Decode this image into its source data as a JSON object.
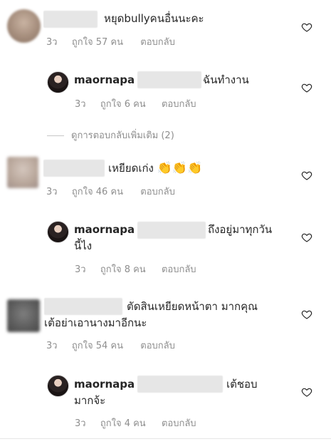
{
  "comments": [
    {
      "text": "หยุดbullyคนอื่นนะคะ",
      "time": "3ว",
      "likes": "ถูกใจ 57 คน",
      "reply": "ตอบกลับ"
    },
    {
      "username": "maornapa",
      "text": "ฉันทำงาน",
      "time": "3ว",
      "likes": "ถูกใจ 6 คน",
      "reply": "ตอบกลับ"
    },
    {
      "text": "เหยียดเก่ง",
      "emoji": "👏👏👏",
      "time": "3ว",
      "likes": "ถูกใจ 46 คน",
      "reply": "ตอบกลับ"
    },
    {
      "username": "maornapa",
      "text_line1": "ถึงอยู่มาทุกวัน",
      "text_line2": "นี้ไง",
      "time": "3ว",
      "likes": "ถูกใจ 8 คน",
      "reply": "ตอบกลับ"
    },
    {
      "text_line1": "ตัดสินเหยียดหน้าตา มากคุณ",
      "text_line2": "เต้อย่าเอานางมาอีกนะ",
      "time": "3ว",
      "likes": "ถูกใจ 54 คน",
      "reply": "ตอบกลับ"
    },
    {
      "username": "maornapa",
      "text_line1": "เต้ชอบ",
      "text_line2": "มากจ้ะ",
      "time": "3ว",
      "likes": "ถูกใจ 4 คน",
      "reply": "ตอบกลับ"
    }
  ],
  "view_replies": "ดูการตอบกลับเพิ่มเติม (2)",
  "icons": {
    "like": "heart-outline-icon"
  },
  "colors": {
    "text": "#262626",
    "meta": "#8e8e8e"
  }
}
